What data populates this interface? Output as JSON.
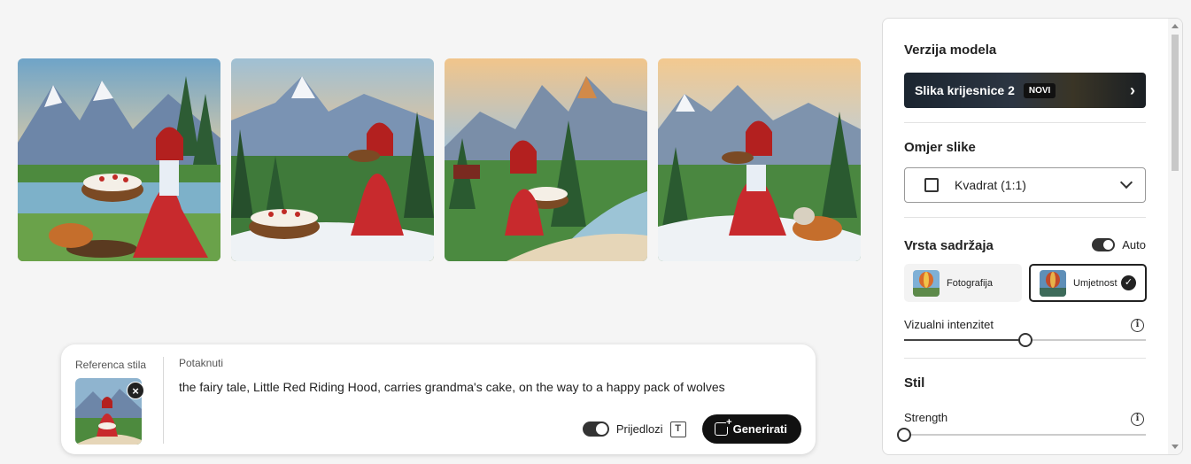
{
  "gallery": {
    "images": [
      {
        "name": "generated-image-1"
      },
      {
        "name": "generated-image-2"
      },
      {
        "name": "generated-image-3"
      },
      {
        "name": "generated-image-4"
      }
    ]
  },
  "prompt_bar": {
    "style_ref_label": "Referenca stila",
    "prompt_label": "Potaknuti",
    "prompt_text": "the fairy tale, Little Red Riding Hood, carries grandma's cake, on the way to a happy pack of wolves",
    "suggestions_label": "Prijedlozi",
    "suggestions_on": true,
    "generate_label": "Generirati"
  },
  "panel": {
    "model": {
      "title": "Verzija modela",
      "name": "Slika krijesnice 2",
      "badge": "NOVI"
    },
    "aspect": {
      "title": "Omjer slike",
      "value": "Kvadrat (1:1)"
    },
    "content_type": {
      "title": "Vrsta sadržaja",
      "auto_label": "Auto",
      "auto_on": true,
      "options": [
        {
          "label": "Fotografija",
          "selected": false
        },
        {
          "label": "Umjetnost",
          "selected": true
        }
      ]
    },
    "visual_intensity": {
      "label": "Vizualni intenzitet",
      "value": 0.5
    },
    "style": {
      "title": "Stil",
      "strength_label": "Strength",
      "strength_value": 0.0
    }
  },
  "colors": {
    "accent_dark": "#111111",
    "background": "#f5f5f5"
  }
}
